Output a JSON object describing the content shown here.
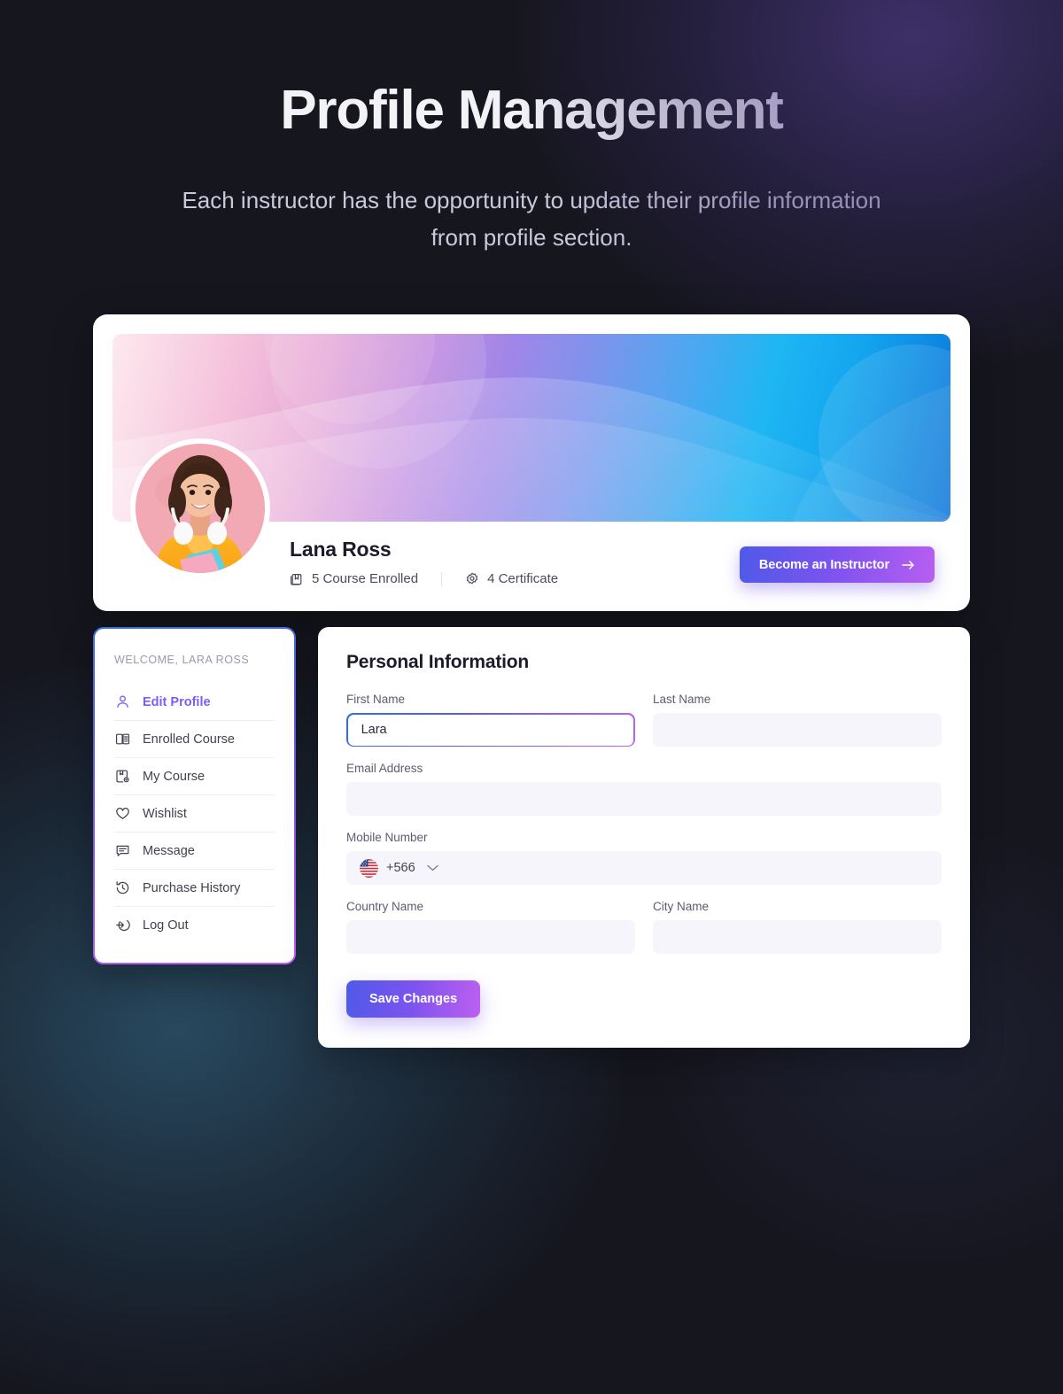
{
  "hero": {
    "title": "Profile Management",
    "subtitle": "Each instructor has the opportunity to update their profile information from profile section."
  },
  "profile": {
    "name": "Lana Ross",
    "stats": [
      {
        "icon": "book-icon",
        "label": "5 Course Enrolled"
      },
      {
        "icon": "certificate-badge-icon",
        "label": "4 Certificate"
      }
    ],
    "instructor_button": "Become an Instructor",
    "instructor_button_icon": "arrow-right-icon",
    "avatar_alt": "Lana Ross profile photo"
  },
  "sidebar": {
    "welcome": "WELCOME, LARA ROSS",
    "items": [
      {
        "label": "Edit Profile",
        "icon": "user-icon",
        "active": true
      },
      {
        "label": "Enrolled Course",
        "icon": "open-book-icon",
        "active": false
      },
      {
        "label": "My Course",
        "icon": "bookmark-badge-icon",
        "active": false
      },
      {
        "label": "Wishlist",
        "icon": "heart-icon",
        "active": false
      },
      {
        "label": "Message",
        "icon": "chat-lines-icon",
        "active": false
      },
      {
        "label": "Purchase History",
        "icon": "history-clock-icon",
        "active": false
      },
      {
        "label": "Log Out",
        "icon": "logout-arrow-icon",
        "active": false
      }
    ]
  },
  "form": {
    "title": "Personal Information",
    "fields": {
      "first_name": {
        "label": "First Name",
        "value": "Lara",
        "placeholder": "",
        "focused": true
      },
      "last_name": {
        "label": "Last Name",
        "value": "",
        "placeholder": ""
      },
      "email": {
        "label": "Email Address",
        "value": "",
        "placeholder": ""
      },
      "mobile": {
        "label": "Mobile Number",
        "value": "",
        "placeholder": "",
        "dial_code": "+566",
        "flag": "us-flag-icon"
      },
      "country": {
        "label": "Country Name",
        "value": "",
        "placeholder": ""
      },
      "city": {
        "label": "City Name",
        "value": "",
        "placeholder": ""
      }
    },
    "save_label": "Save Changes"
  },
  "colors": {
    "page_background": "#16161f",
    "accent_purple": "#7c5cfa",
    "accent_blue": "#4f5ae8",
    "accent_magenta": "#bd60f0",
    "card_white": "#ffffff",
    "input_background": "#f5f5fb",
    "heading_text": "#1b1b2b",
    "muted_text": "#9a9aab"
  }
}
